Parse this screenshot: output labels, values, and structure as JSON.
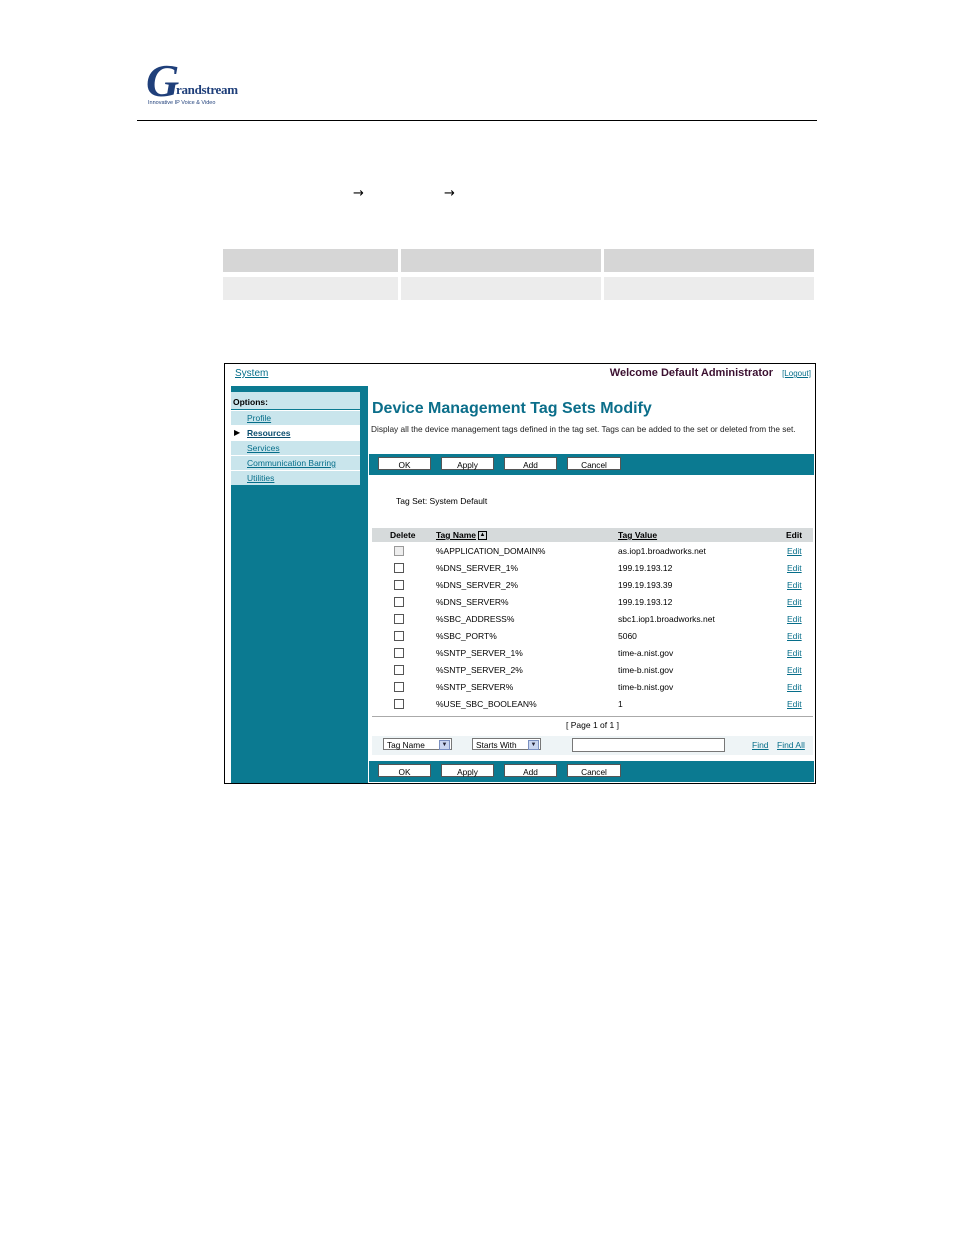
{
  "header": {
    "logo_mark": "G",
    "logo_brand": "randstream",
    "logo_tagline": "Innovative IP Voice & Video",
    "nav_arrows": [
      "→",
      "→"
    ]
  },
  "screenshot": {
    "topbar": {
      "system_link": "System",
      "welcome": "Welcome Default Administrator",
      "logout": "[Logout]"
    },
    "sidebar": {
      "options_label": "Options:",
      "pointer": "▶",
      "items": [
        {
          "label": "Profile"
        },
        {
          "label": "Resources"
        },
        {
          "label": "Services"
        },
        {
          "label": "Communication Barring"
        },
        {
          "label": "Utilities"
        }
      ]
    },
    "main": {
      "title": "Device Management Tag Sets Modify",
      "description": "Display all the device management tags defined in the tag set. Tags can be added to the set or deleted from the set.",
      "buttons": {
        "ok": "OK",
        "apply": "Apply",
        "add": "Add",
        "cancel": "Cancel"
      },
      "tag_set_label": "Tag Set: System Default",
      "table": {
        "headers": {
          "delete": "Delete",
          "tag_name": "Tag Name",
          "tag_value": "Tag Value",
          "edit": "Edit"
        },
        "sort_indicator": "▲",
        "rows": [
          {
            "tag_name": "%APPLICATION_DOMAIN%",
            "tag_value": "as.iop1.broadworks.net",
            "edit": "Edit"
          },
          {
            "tag_name": "%DNS_SERVER_1%",
            "tag_value": "199.19.193.12",
            "edit": "Edit"
          },
          {
            "tag_name": "%DNS_SERVER_2%",
            "tag_value": "199.19.193.39",
            "edit": "Edit"
          },
          {
            "tag_name": "%DNS_SERVER%",
            "tag_value": "199.19.193.12",
            "edit": "Edit"
          },
          {
            "tag_name": "%SBC_ADDRESS%",
            "tag_value": "sbc1.iop1.broadworks.net",
            "edit": "Edit"
          },
          {
            "tag_name": "%SBC_PORT%",
            "tag_value": "5060",
            "edit": "Edit"
          },
          {
            "tag_name": "%SNTP_SERVER_1%",
            "tag_value": "time-a.nist.gov",
            "edit": "Edit"
          },
          {
            "tag_name": "%SNTP_SERVER_2%",
            "tag_value": "time-b.nist.gov",
            "edit": "Edit"
          },
          {
            "tag_name": "%SNTP_SERVER%",
            "tag_value": "time-b.nist.gov",
            "edit": "Edit"
          },
          {
            "tag_name": "%USE_SBC_BOOLEAN%",
            "tag_value": "1",
            "edit": "Edit"
          }
        ]
      },
      "pager": "[ Page 1 of 1 ]",
      "search": {
        "field_select": "Tag Name",
        "mode_select": "Starts With",
        "dropdown_glyph": "▼",
        "input_value": "",
        "find": "Find",
        "find_all": "Find All"
      }
    }
  }
}
